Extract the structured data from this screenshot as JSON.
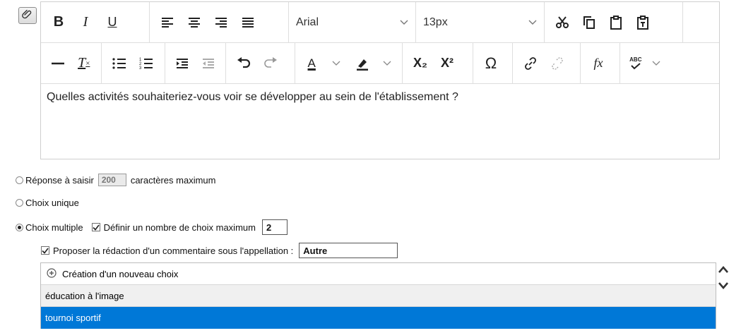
{
  "toolbar": {
    "row1": {
      "bold": "B",
      "italic": "I",
      "underline": "U",
      "font_family": "Arial",
      "font_size": "13px"
    },
    "row2": {
      "remove_format": "T",
      "font_color_letter": "A",
      "subscript": "X₂",
      "superscript": "X²",
      "special_char": "Ω",
      "formula": "fx",
      "spellcheck": "ABC"
    }
  },
  "editor": {
    "text": "Quelles activités souhaiteriez-vous voir se développer au sein de l'établissement ?"
  },
  "options": {
    "free_text": {
      "label_before": "Réponse à saisir",
      "max_chars": "200",
      "label_after": "caractères maximum",
      "selected": false
    },
    "single_choice": {
      "label": "Choix unique",
      "selected": false
    },
    "multiple_choice": {
      "label": "Choix multiple",
      "selected": true,
      "max_choice_label": "Définir un nombre de choix maximum",
      "max_choice_checked": true,
      "max_choice_value": "2"
    },
    "comment": {
      "label": "Proposer la rédaction d'un commentaire sous l'appellation :",
      "checked": true,
      "value": "Autre"
    }
  },
  "choices": {
    "add_label": "Création d'un nouveau choix",
    "items": [
      {
        "label": "éducation à l'image",
        "selected": false
      },
      {
        "label": "tournoi sportif",
        "selected": true
      }
    ]
  },
  "colors": {
    "selection": "#0078d7",
    "row_alt": "#f0f0f0",
    "toolbar_border": "#dedede"
  }
}
